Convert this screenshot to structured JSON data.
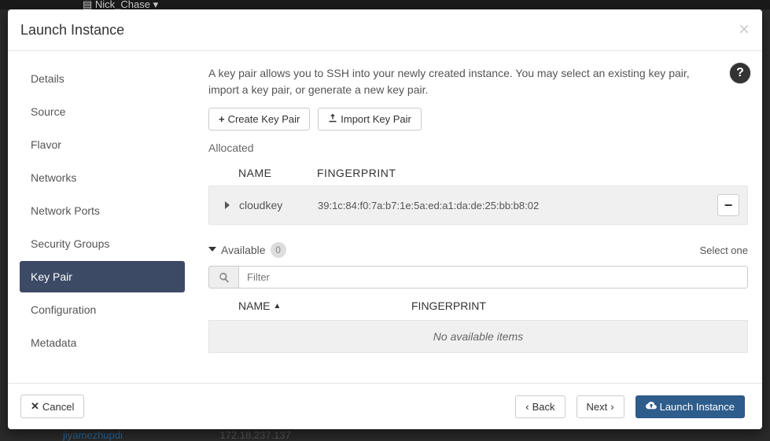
{
  "background": {
    "user_label": "Nick_Chase",
    "row_link": "jiyamezhupdi",
    "row_ip": "172.18.237.137"
  },
  "modal": {
    "title": "Launch Instance",
    "sidebar": [
      {
        "label": "Details",
        "active": false
      },
      {
        "label": "Source",
        "active": false
      },
      {
        "label": "Flavor",
        "active": false
      },
      {
        "label": "Networks",
        "active": false
      },
      {
        "label": "Network Ports",
        "active": false
      },
      {
        "label": "Security Groups",
        "active": false
      },
      {
        "label": "Key Pair",
        "active": true
      },
      {
        "label": "Configuration",
        "active": false
      },
      {
        "label": "Metadata",
        "active": false
      }
    ],
    "content": {
      "description": "A key pair allows you to SSH into your newly created instance. You may select an existing key pair, import a key pair, or generate a new key pair.",
      "create_btn": "Create Key Pair",
      "import_btn": "Import Key Pair",
      "allocated_label": "Allocated",
      "cols": {
        "name": "NAME",
        "fingerprint": "FINGERPRINT"
      },
      "allocated_rows": [
        {
          "name": "cloudkey",
          "fingerprint": "39:1c:84:f0:7a:b7:1e:5a:ed:a1:da:de:25:bb:b8:02"
        }
      ],
      "available_label": "Available",
      "available_count": "0",
      "select_one": "Select one",
      "filter_placeholder": "Filter",
      "empty_text": "No available items"
    },
    "footer": {
      "cancel": "Cancel",
      "back": "Back",
      "next": "Next",
      "launch": "Launch Instance"
    }
  }
}
